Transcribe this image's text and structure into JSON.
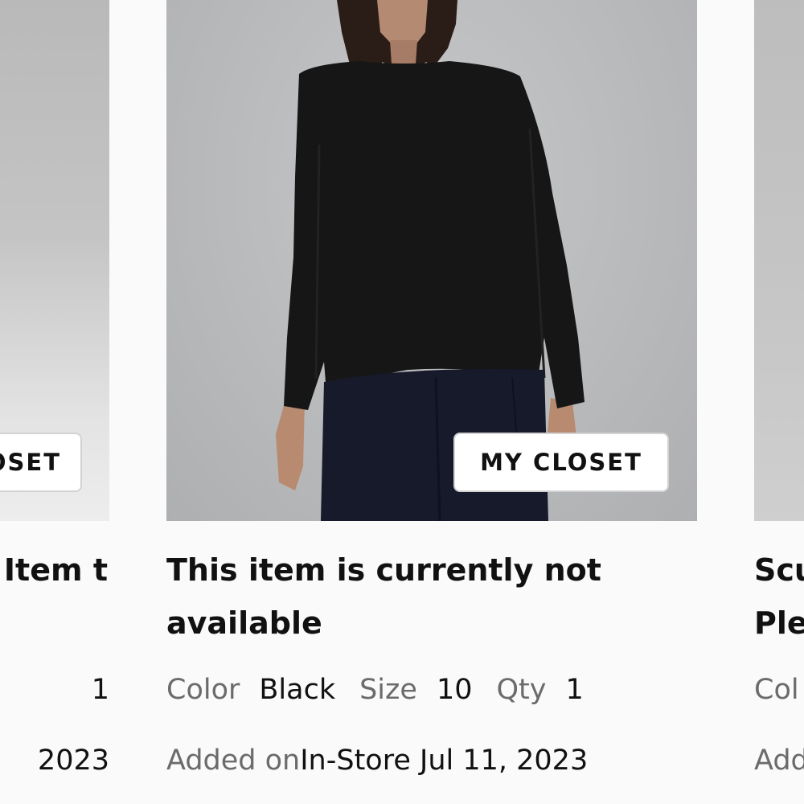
{
  "products": [
    {
      "position": "left",
      "closet_button": "MY CLOSET",
      "title": "Item t",
      "qty_value": "1",
      "added_date": "2023"
    },
    {
      "position": "center",
      "closet_button": "MY CLOSET",
      "title": "This item is currently not available",
      "color_label": "Color",
      "color_value": "Black",
      "size_label": "Size",
      "size_value": "10",
      "qty_label": "Qty",
      "qty_value": "1",
      "added_label": "Added on",
      "added_value": "In-Store Jul 11, 2023"
    },
    {
      "position": "right",
      "title_line1": "Scu",
      "title_line2": "Ple",
      "color_label": "Col",
      "added_label": "Add"
    }
  ],
  "colors": {
    "background": "#fafafa",
    "label_gray": "#6b6b6b",
    "text_dark": "#111111",
    "button_border": "#d2d2d2"
  }
}
